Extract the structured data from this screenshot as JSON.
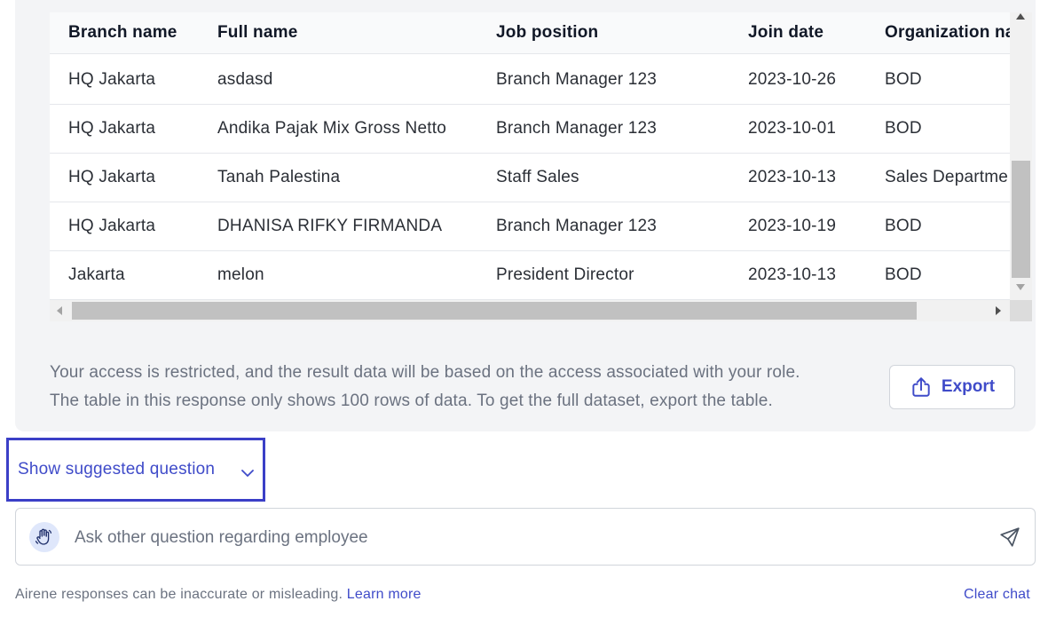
{
  "table": {
    "columns": [
      "Branch name",
      "Full name",
      "Job position",
      "Join date",
      "Organization na"
    ],
    "rows": [
      [
        "HQ Jakarta",
        "asdasd",
        "Branch Manager 123",
        "2023-10-26",
        "BOD"
      ],
      [
        "HQ Jakarta",
        "Andika Pajak Mix Gross Netto",
        "Branch Manager 123",
        "2023-10-01",
        "BOD"
      ],
      [
        "HQ Jakarta",
        "Tanah Palestina",
        "Staff Sales",
        "2023-10-13",
        "Sales Departme"
      ],
      [
        "HQ Jakarta",
        "DHANISA RIFKY FIRMANDA",
        "Branch Manager 123",
        "2023-10-19",
        "BOD"
      ],
      [
        "Jakarta",
        "melon",
        "President Director",
        "2023-10-13",
        "BOD"
      ]
    ]
  },
  "notice": {
    "line1": "Your access is restricted, and the result data will be based on the access associated with your role.",
    "line2": "The table in this response only shows 100 rows of data. To get the full dataset, export the table."
  },
  "export": {
    "label": "Export",
    "icon": "share-upload-icon"
  },
  "suggested": {
    "label": "Show suggested question",
    "icon": "chevron-down-icon"
  },
  "ask": {
    "placeholder": "Ask other question regarding employee",
    "avatar_icon": "waving-hand-icon",
    "send_icon": "send-icon"
  },
  "footer": {
    "disclaimer": "Airene responses can be inaccurate or misleading.",
    "learn_more": "Learn more",
    "clear_chat": "Clear chat"
  },
  "colors": {
    "accent": "#3f4bc9",
    "highlight_border": "#3b3fc7",
    "panel_bg": "#f3f4f6"
  }
}
